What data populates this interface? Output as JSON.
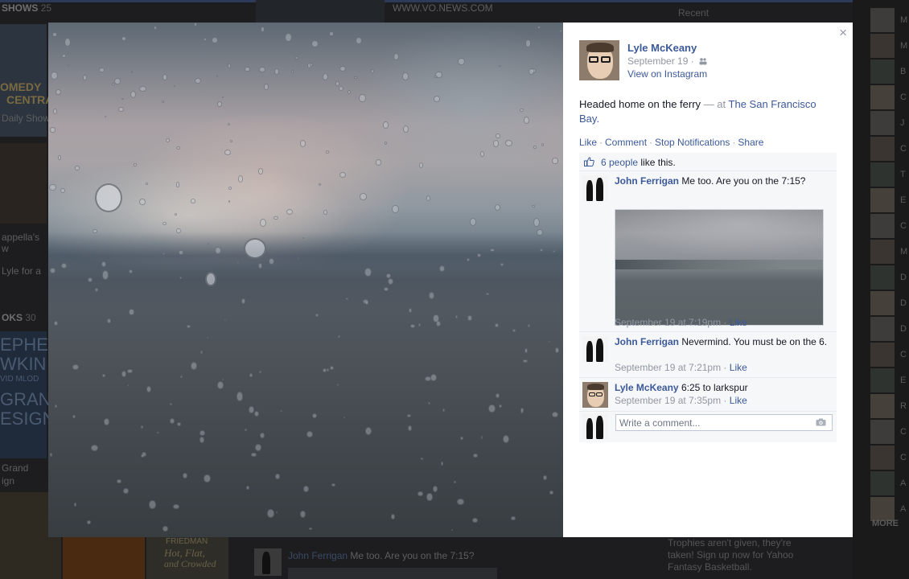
{
  "background": {
    "section_shows": "SHOWS",
    "section_shows_count": "25",
    "section_books": "OKS",
    "section_books_count": "30",
    "bg_texts": [
      "OMEDY",
      "CENTRA",
      "Daily Show",
      "appella's",
      "w",
      "Lyle for a",
      "EPHE",
      "WKIN",
      "VID MLOD",
      "GRAN",
      "ESIGN",
      "Grand",
      "ign",
      "WWW.VO.NEWS.COM"
    ],
    "right_label": "Recent",
    "ad_text": "Trophies aren't given, they're taken! Sign up now for Yahoo Fantasy Basketball.",
    "book_titles": [
      "Hot, Flat,",
      "and Crowded",
      "FRIEDMAN"
    ],
    "bottom_comment_name": "John Ferrigan",
    "bottom_comment_text": "Me too. Are you on the 7:15?",
    "rail_letters": [
      "M",
      "M",
      "B",
      "C",
      "J",
      "C",
      "T",
      "E",
      "C",
      "M",
      "D",
      "D",
      "D",
      "C",
      "E",
      "R",
      "C",
      "C",
      "A",
      "A"
    ],
    "rail_heading": "MORE"
  },
  "lightbox": {
    "close_label": "×",
    "post": {
      "author": "Lyle McKeany",
      "date": "September 19",
      "date_sep": "·",
      "audience_icon": "people-icon",
      "source_link": "View on Instagram",
      "caption": "Headed home on the ferry",
      "caption_dash": "—",
      "caption_at": "at",
      "location": "The San Francisco Bay",
      "caption_end": "."
    },
    "actions": {
      "like": "Like",
      "comment": "Comment",
      "stop_notifications": "Stop Notifications",
      "share": "Share",
      "separator": "·"
    },
    "likes": {
      "count_link": "6 people",
      "suffix": "like this."
    },
    "comments": [
      {
        "name": "John Ferrigan",
        "text": "Me too. Are you on the 7:15?",
        "time": "September 19 at 7:19pm",
        "like": "Like",
        "has_photo": true
      },
      {
        "name": "John Ferrigan",
        "text": "Nevermind. You must be on the 6.",
        "time": "September 19 at 7:21pm",
        "like": "Like"
      },
      {
        "name": "Lyle McKeany",
        "text": "6:25 to larkspur",
        "time": "September 19 at 7:35pm",
        "like": "Like"
      }
    ],
    "composer": {
      "placeholder": "Write a comment...",
      "camera_icon": "camera-icon"
    }
  },
  "colors": {
    "link": "#3b5998",
    "muted": "#9197a3",
    "ufi_bg": "#f6f7f9"
  }
}
